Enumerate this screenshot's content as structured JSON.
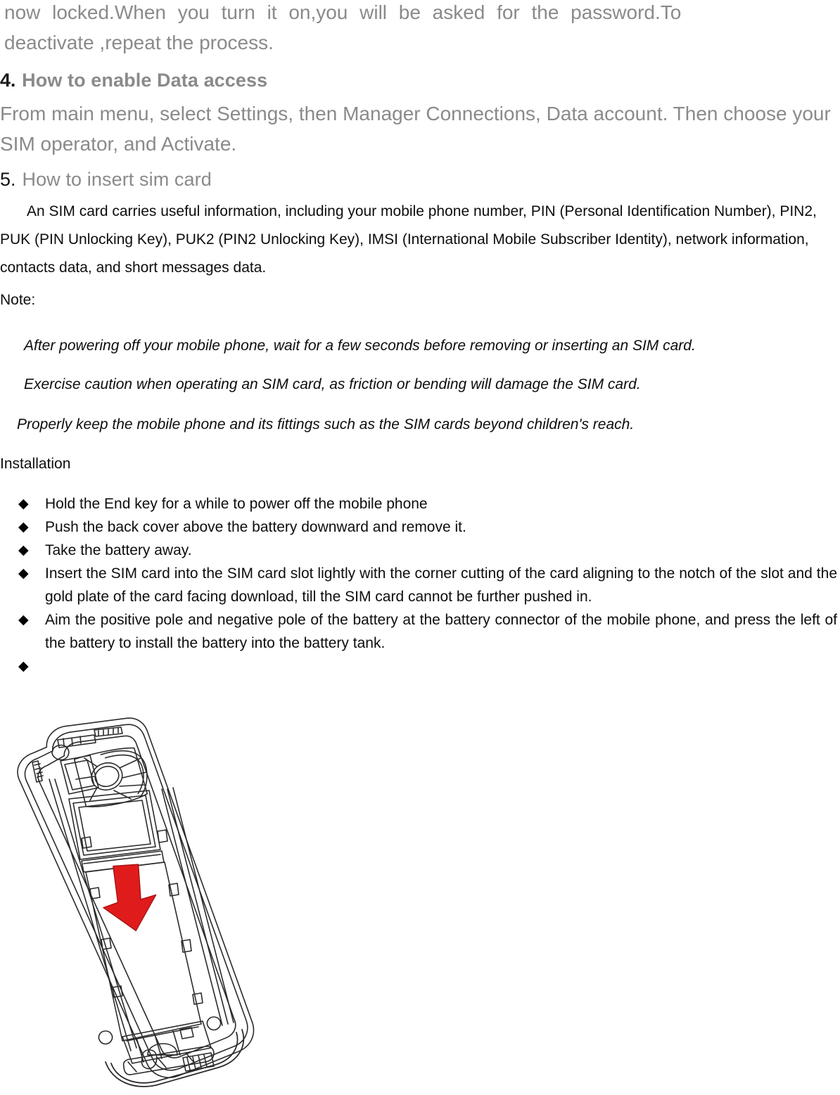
{
  "page": {
    "continuation_paragraph": {
      "line1": "now locked.When you turn it on,you will be asked for the password.To",
      "line2": "deactivate ,repeat the process."
    },
    "sections": [
      {
        "number": "4.",
        "title": "How to enable Data access",
        "body": "From main menu, select Settings, then Manager Connections, Data account. Then choose your SIM operator, and Activate."
      },
      {
        "number": "5.",
        "title": "How to insert sim card",
        "body": "An SIM card carries useful information, including your mobile phone number, PIN (Personal Identification Number), PIN2, PUK (PIN Unlocking Key), PUK2 (PIN2 Unlocking Key), IMSI (International Mobile Subscriber Identity), network information, contacts data, and short messages data."
      }
    ],
    "note": {
      "label": "Note:",
      "items": [
        "After powering off your mobile phone, wait for a few seconds before removing or inserting an SIM card.",
        "Exercise caution when operating an SIM card, as friction or bending will damage the SIM card.",
        "Properly keep the mobile phone and its fittings such as the SIM cards beyond children's reach."
      ]
    },
    "installation": {
      "label": "Installation",
      "bullet_glyph": "◆",
      "steps": [
        "Hold the End key for a while to power off the mobile phone",
        "Push the back cover above the battery downward and remove it.",
        "Take the battery away.",
        "Insert the SIM card into the SIM card slot lightly with the corner cutting of the card aligning to the notch of the slot and the gold plate of the card facing download, till the SIM card cannot be further pushed in.",
        "Aim the positive pole and negative pole of the battery at the battery connector of the mobile phone, and press the left of the battery to install the battery into the battery tank.",
        ""
      ]
    },
    "figure": {
      "name": "phone-battery-compartment-diagram",
      "description": "Line drawing of a mobile phone with back cover removed showing the battery compartment and SIM slot, with a red downward arrow indicating battery insertion direction.",
      "arrow_color": "#E01B1B",
      "line_color": "#2b2b2b"
    },
    "colors": {
      "gray_text": "#8a8a8a",
      "black_text": "#0d0d0d",
      "arrow_red": "#E01B1B"
    }
  }
}
